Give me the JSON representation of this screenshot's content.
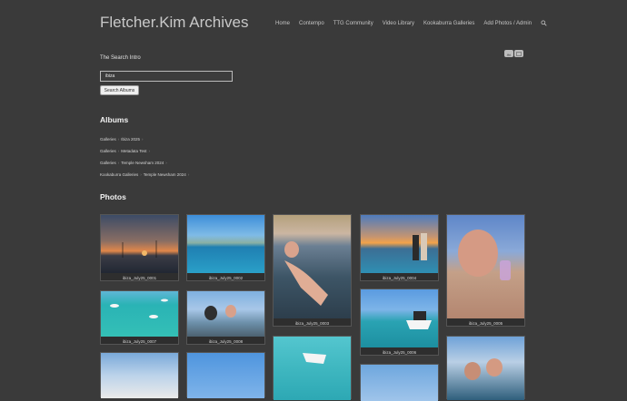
{
  "site": {
    "title": "Fletcher.Kim Archives"
  },
  "nav": {
    "items": [
      "Home",
      "Contempo",
      "TTG Community",
      "Video Library",
      "Kookaburra Galleries",
      "Add Photos / Admin"
    ]
  },
  "search": {
    "intro": "The Search Intro",
    "value": "ibiza",
    "button_label": "Search Albums"
  },
  "albums": {
    "heading": "Albums",
    "rows": [
      {
        "parent": "Galleries",
        "name": "Ibiza 2025"
      },
      {
        "parent": "Galleries",
        "name": "Metadata Test"
      },
      {
        "parent": "Galleries",
        "name": "Temple Newsham 2024"
      },
      {
        "parent": "Kookaburra Galleries",
        "name": "Temple Newsham 2024"
      }
    ]
  },
  "photos": {
    "heading": "Photos",
    "items": [
      {
        "caption": "ibiza_July25_0001"
      },
      {
        "caption": "ibiza_July25_0002"
      },
      {
        "caption": "ibiza_July25_0003"
      },
      {
        "caption": "ibiza_July25_0004"
      },
      {
        "caption": "ibiza_July25_0005"
      },
      {
        "caption": "ibiza_July25_0007"
      },
      {
        "caption": "ibiza_July25_0008"
      },
      {
        "caption": "ibiza_July25_0006"
      }
    ]
  },
  "colors": {
    "background": "#3a3a3a",
    "sea": "#2fa8b8",
    "sky": "#5b9fd6"
  }
}
